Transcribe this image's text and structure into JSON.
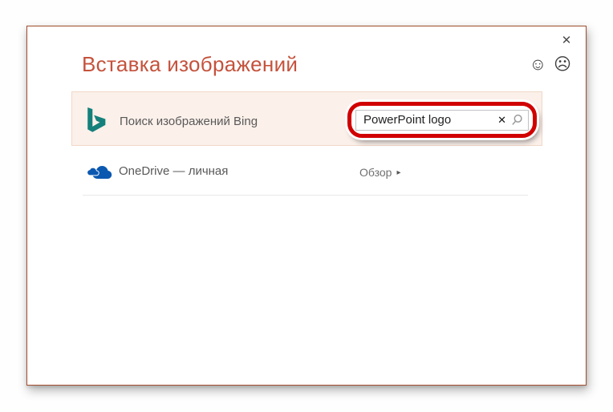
{
  "window": {
    "title": "Вставка изображений",
    "close_icon": "✕"
  },
  "feedback": {
    "happy_icon": "☺",
    "sad_icon": "☹"
  },
  "sources": [
    {
      "name": "Bing",
      "label": "Поиск изображений Bing",
      "search": {
        "value": "PowerPoint logo",
        "placeholder": "",
        "clear_icon": "✕"
      }
    },
    {
      "name": "OneDrive",
      "label": "OneDrive — личная",
      "action": {
        "label": "Обзор",
        "arrow": "▸"
      }
    }
  ],
  "colors": {
    "accent_border": "#a24e30",
    "title_text": "#c5523c",
    "bing_row_bg": "#fbf0ea",
    "bing_teal": "#15807b",
    "onedrive_blue": "#0b58b0",
    "annotation_red": "#d10000",
    "label_gray": "#595959"
  }
}
